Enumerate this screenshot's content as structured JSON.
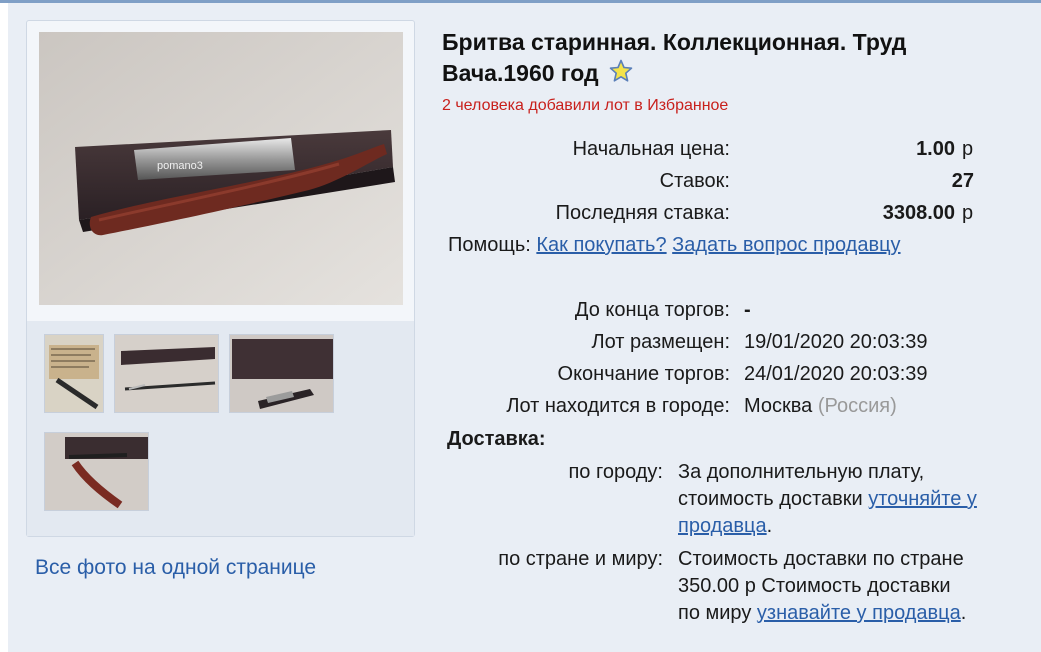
{
  "lot": {
    "title": "Бритва старинная. Коллекционная. Труд Вача.1960 год",
    "favorites_text": "2 человека добавили лот в Избранное"
  },
  "gallery": {
    "all_photos_link": "Все фото на одной странице",
    "main_photo_watermark": "pomano3",
    "thumbnails": [
      "photo-1",
      "photo-2",
      "photo-3",
      "photo-4"
    ]
  },
  "pricing": {
    "start_price_label": "Начальная цена:",
    "start_price_value": "1.00",
    "start_price_currency": "р",
    "bids_label": "Ставок:",
    "bids_value": "27",
    "last_bid_label": "Последняя ставка:",
    "last_bid_value": "3308.00",
    "last_bid_currency": "р"
  },
  "help": {
    "label": "Помощь:",
    "how_to_buy": "Как покупать?",
    "ask_seller": "Задать вопрос продавцу"
  },
  "timing": {
    "ends_in_label": "До конца торгов:",
    "ends_in_value": "-",
    "posted_label": "Лот размещен:",
    "posted_value": "19/01/2020 20:03:39",
    "end_label": "Окончание торгов:",
    "end_value": "24/01/2020 20:03:39",
    "city_label": "Лот находится в городе:",
    "city_value": "Москва",
    "country_value": "(Россия)"
  },
  "delivery": {
    "heading": "Доставка:",
    "city_label": "по городу:",
    "city_text_1": "За дополнительную плату,",
    "city_text_2": "стоимость доставки",
    "city_link": "уточняйте у продавца",
    "city_end": ".",
    "world_label": "по стране и миру:",
    "world_text_1": "Стоимость доставки по стране",
    "world_text_2": "350.00 р Стоимость доставки",
    "world_text_3": "по миру",
    "world_link": "узнавайте у продавца",
    "world_end": "."
  },
  "colors": {
    "link": "#2a5ea8",
    "favorites": "#c8201c",
    "panel": "#e9eef5"
  }
}
